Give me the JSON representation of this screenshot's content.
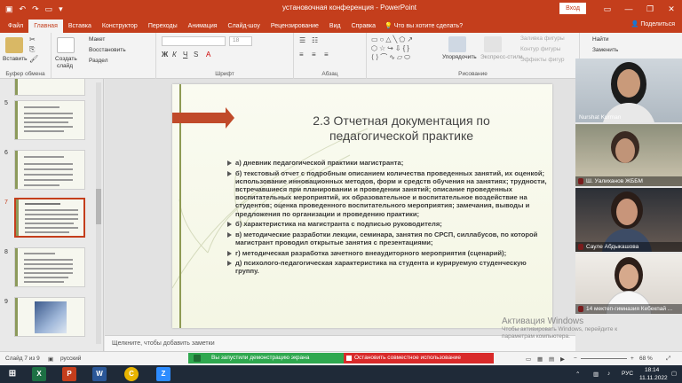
{
  "window": {
    "title": "установочная конференция - PowerPoint",
    "signin": "Вход",
    "controls": [
      "—",
      "❐",
      "✕"
    ],
    "share": "Поделиться",
    "tell_me": "Что вы хотите сделать?"
  },
  "tabs": [
    {
      "label": "Файл"
    },
    {
      "label": "Главная",
      "active": true
    },
    {
      "label": "Вставка"
    },
    {
      "label": "Конструктор"
    },
    {
      "label": "Переходы"
    },
    {
      "label": "Анимация"
    },
    {
      "label": "Слайд-шоу"
    },
    {
      "label": "Рецензирование"
    },
    {
      "label": "Вид"
    },
    {
      "label": "Справка"
    }
  ],
  "ribbon": {
    "clipboard": {
      "paste": "Вставить",
      "label": "Буфер обмена"
    },
    "slides": {
      "create": "Создать",
      "slide": "слайд",
      "layout": "Макет",
      "reset": "Восстановить",
      "section": "Раздел"
    },
    "font": {
      "label": "Шрифт",
      "size": "18"
    },
    "paragraph": {
      "label": "Абзац"
    },
    "drawing": {
      "label": "Рисование",
      "arrange": "Упорядочить",
      "styles": "Экспресс-стили",
      "fill": "Заливка фигуры",
      "outline": "Контур фигуры",
      "effects": "Эффекты фигур"
    },
    "editing": {
      "find": "Найти",
      "replace": "Заменить"
    }
  },
  "thumbnails": [
    {
      "num": "5",
      "lines": 6
    },
    {
      "num": "6",
      "lines": 6
    },
    {
      "num": "7",
      "lines": 7,
      "selected": true
    },
    {
      "num": "8",
      "lines": 7
    },
    {
      "num": "9",
      "photo": true
    }
  ],
  "slide": {
    "title": "2.3 Отчетная документация по педагогической практике",
    "bullets": [
      "а) дневник педагогической практики магистранта;",
      "б) текстовый отчет с подробным описанием количества проведенных занятий, их оценкой; использование инновационных методов, форм и средств обучения на занятиях; трудности, встречавшиеся при планировании и проведении занятий; описание проведенных воспитательных мероприятий, их образовательное и воспитательное воздействие на студентов; оценка проведенного воспитательного мероприятия; замечания, выводы и предложения по организации и проведению практики;",
      "б) характеристика на магистранта с подписью руководителя;",
      "в) методические разработки лекции, семинара, занятия по СРСП, силлабусов, по которой магистрант проводил открытые занятия с презентациями;",
      "г) методическая разработка зачетного внеаудиторного мероприятия (сценарий);",
      "д) психолого-педагогическая характеристика на студента и курируемую студенческую группу."
    ]
  },
  "notes_placeholder": "Щелкните, чтобы добавить заметки",
  "watermark": {
    "title": "Активация Windows",
    "line1": "Чтобы активировать Windows, перейдите к",
    "line2": "параметрам компьютера."
  },
  "participants": [
    {
      "name": "Nurshat Kurman"
    },
    {
      "name": "Ш. Уалиханов ЖББМ"
    },
    {
      "name": "Сауле Абдыкашова"
    },
    {
      "name": "14 мектеп-гимназия Кебекпай ..."
    }
  ],
  "status": {
    "slide_pos": "Слайд 7 из 9",
    "language": "русский",
    "sharing_msg": "Вы запустили демонстрацию экрана",
    "stop_label": "Остановить совместное использование",
    "zoom": "68 %"
  },
  "taskbar": {
    "apps": [
      "X",
      "P",
      "W",
      "C",
      "Z"
    ],
    "lang": "РУС",
    "time": "18:14",
    "date": "11.11.2022"
  }
}
